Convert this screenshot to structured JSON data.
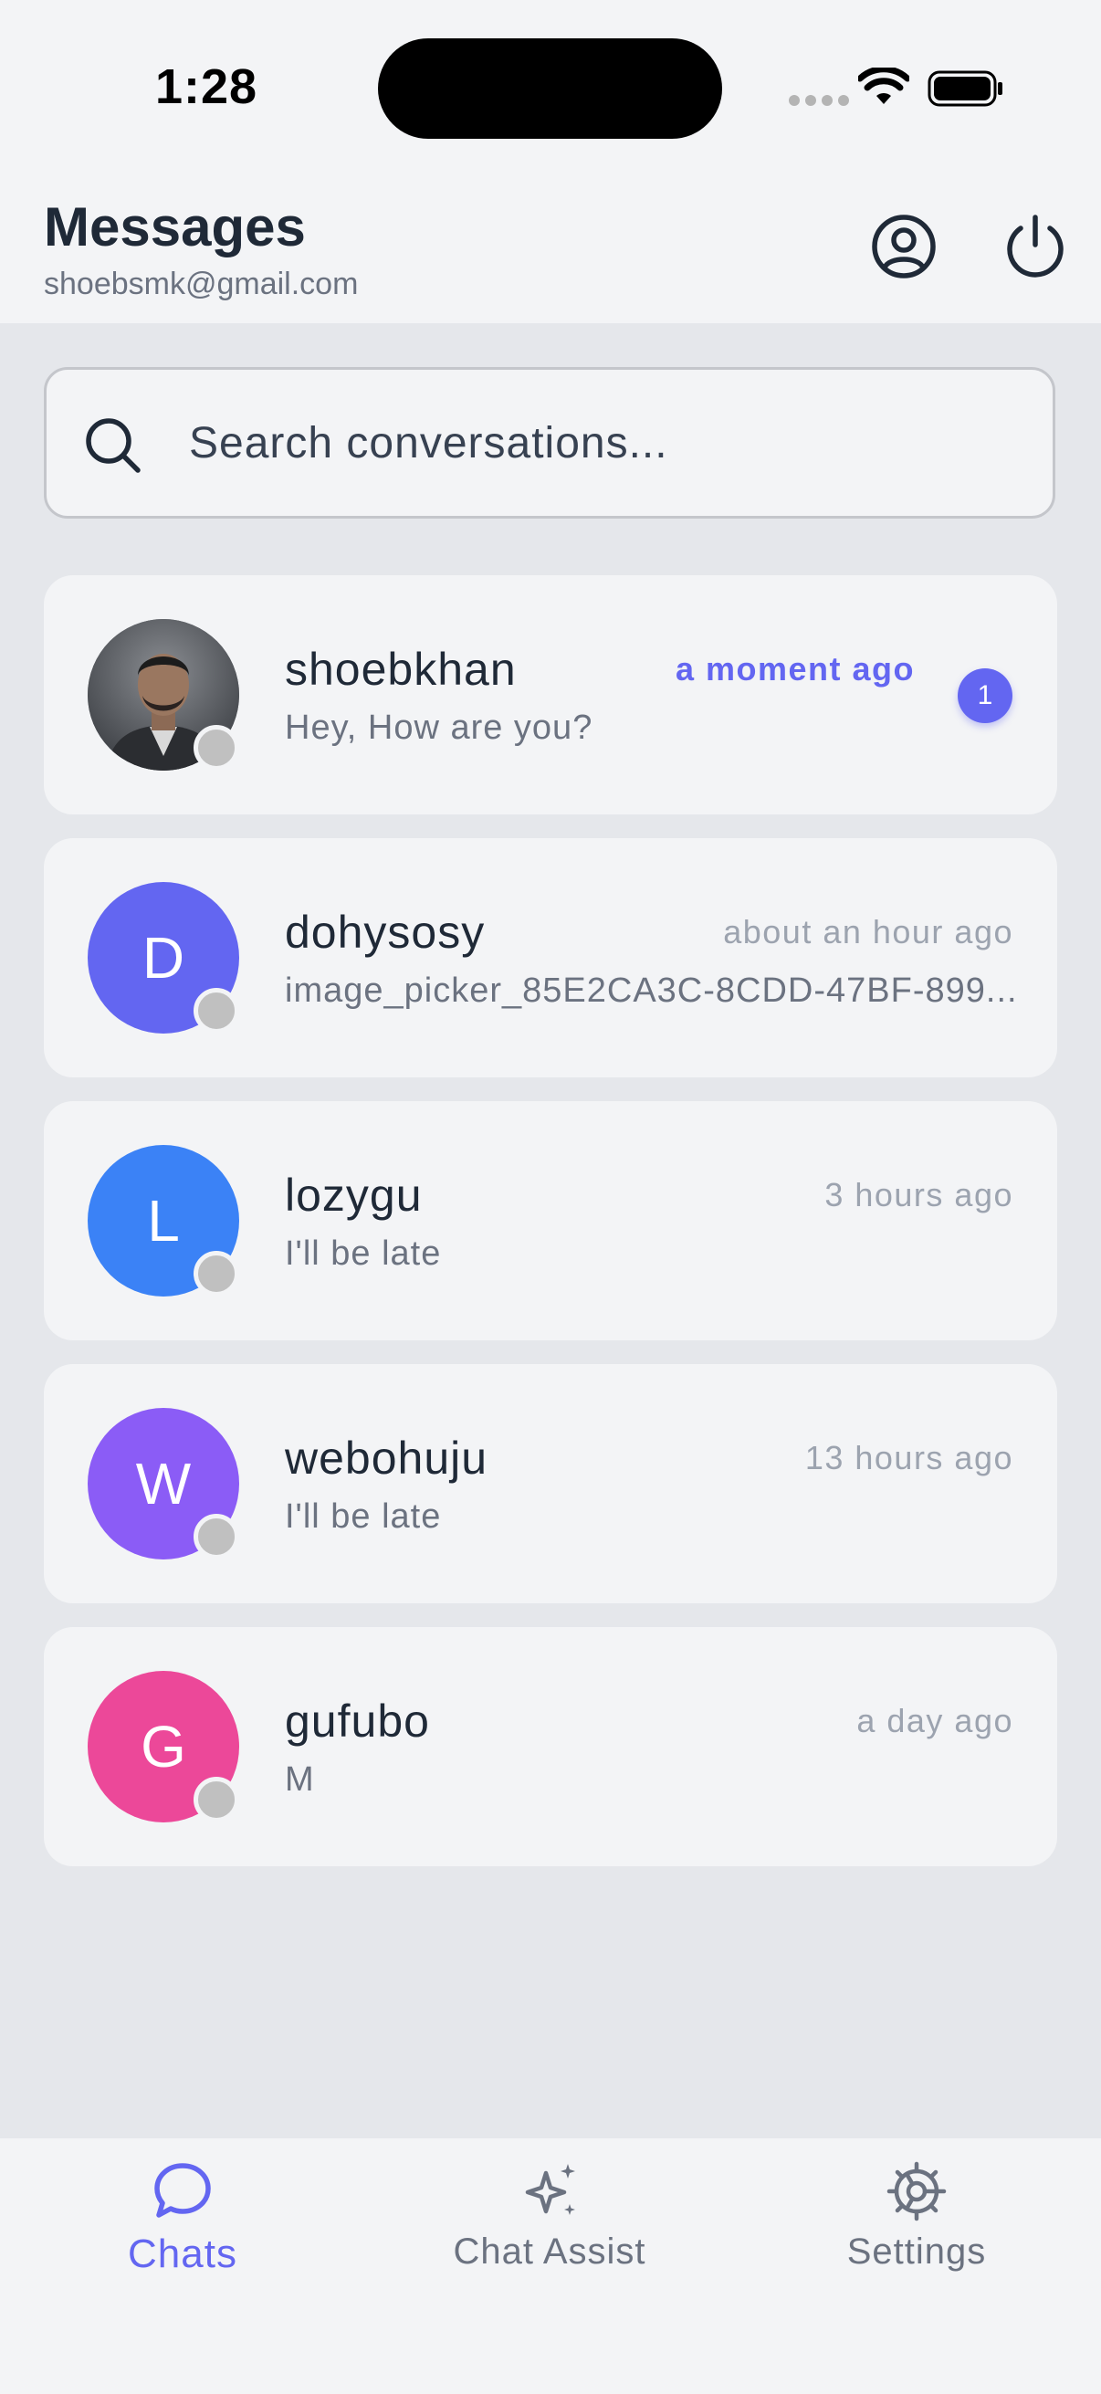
{
  "status_bar": {
    "time": "1:28"
  },
  "header": {
    "title": "Messages",
    "email": "shoebsmk@gmail.com"
  },
  "search": {
    "placeholder": "Search conversations...",
    "value": ""
  },
  "conversations": [
    {
      "name": "shoebkhan",
      "preview": "Hey, How are you?",
      "time": "a moment ago",
      "unread_count": "1",
      "avatar_type": "photo",
      "avatar_letter": "",
      "avatar_color": "#4b5563"
    },
    {
      "name": "dohysosy",
      "preview": "image_picker_85E2CA3C-8CDD-47BF-899...",
      "time": "about an hour ago",
      "avatar_type": "letter",
      "avatar_letter": "D",
      "avatar_color": "#6366f1"
    },
    {
      "name": "lozygu",
      "preview": "I'll be late",
      "time": "3 hours ago",
      "avatar_type": "letter",
      "avatar_letter": "L",
      "avatar_color": "#3b82f6"
    },
    {
      "name": "webohuju",
      "preview": "I'll be late",
      "time": "13 hours ago",
      "avatar_type": "letter",
      "avatar_letter": "W",
      "avatar_color": "#8b5cf6"
    },
    {
      "name": "gufubo",
      "preview": "M",
      "time": "a day ago",
      "avatar_type": "letter",
      "avatar_letter": "G",
      "avatar_color": "#ec4899"
    }
  ],
  "bottom_nav": {
    "items": [
      {
        "label": "Chats",
        "icon": "chat-bubble-icon",
        "active": true
      },
      {
        "label": "Chat Assist",
        "icon": "sparkles-icon",
        "active": false
      },
      {
        "label": "Settings",
        "icon": "gear-icon",
        "active": false
      }
    ]
  },
  "colors": {
    "accent": "#6366f1",
    "background": "#e5e7eb",
    "card": "#f3f4f6",
    "muted_text": "#6b7280",
    "presence_offline": "#c0c0c0"
  }
}
